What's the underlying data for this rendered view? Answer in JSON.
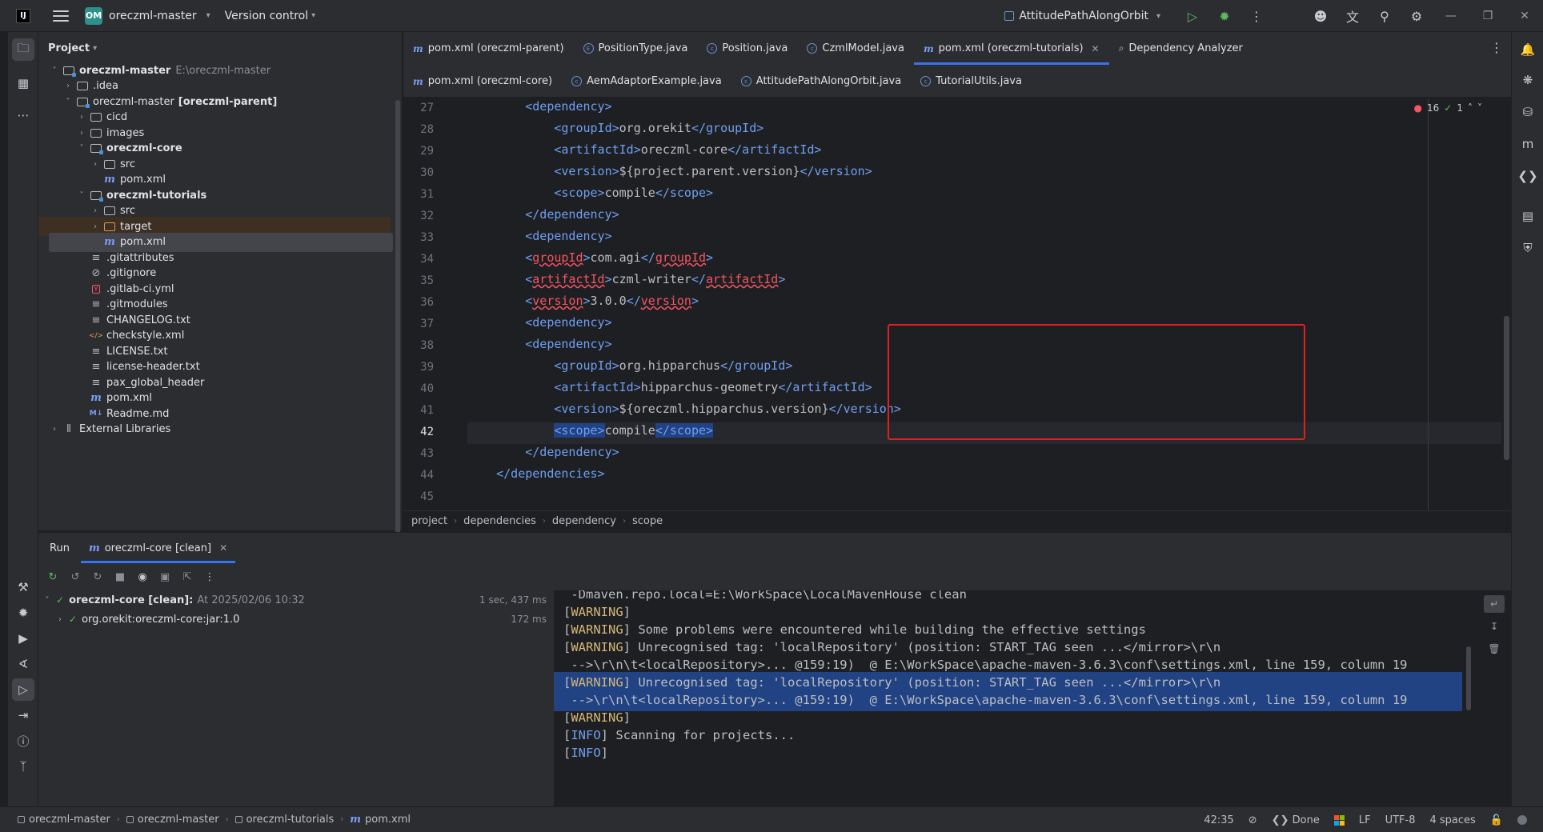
{
  "titlebar": {
    "logo": "IJ",
    "project_badge": "OM",
    "project_name": "oreczml-master",
    "vcs_label": "Version control",
    "run_config": "AttitudePathAlongOrbit"
  },
  "project_panel": {
    "title": "Project",
    "tree": [
      {
        "label": "oreczml-master",
        "extra": "E:\\oreczml-master",
        "indent": 0,
        "expanded": true,
        "icon": "module-folder",
        "bold": true
      },
      {
        "label": ".idea",
        "indent": 1,
        "expanded": false,
        "icon": "folder"
      },
      {
        "label": "oreczml-master",
        "extra": "[oreczml-parent]",
        "indent": 1,
        "expanded": true,
        "icon": "module-folder",
        "bold_extra": true
      },
      {
        "label": "cicd",
        "indent": 2,
        "expanded": false,
        "icon": "folder"
      },
      {
        "label": "images",
        "indent": 2,
        "expanded": false,
        "icon": "folder"
      },
      {
        "label": "oreczml-core",
        "indent": 2,
        "expanded": true,
        "icon": "module-folder",
        "bold": true
      },
      {
        "label": "src",
        "indent": 3,
        "expanded": false,
        "icon": "folder"
      },
      {
        "label": "pom.xml",
        "indent": 3,
        "icon": "maven-file"
      },
      {
        "label": "oreczml-tutorials",
        "indent": 2,
        "expanded": true,
        "icon": "module-folder",
        "bold": true
      },
      {
        "label": "src",
        "indent": 3,
        "expanded": false,
        "icon": "folder"
      },
      {
        "label": "target",
        "indent": 3,
        "expanded": false,
        "icon": "folder-orange",
        "highlight": true
      },
      {
        "label": "pom.xml",
        "indent": 3,
        "icon": "maven-file",
        "selected": true
      },
      {
        "label": ".gitattributes",
        "indent": 2,
        "icon": "lines-file"
      },
      {
        "label": ".gitignore",
        "indent": 2,
        "icon": "ignore-file"
      },
      {
        "label": ".gitlab-ci.yml",
        "indent": 2,
        "icon": "yaml-file"
      },
      {
        "label": ".gitmodules",
        "indent": 2,
        "icon": "lines-file"
      },
      {
        "label": "CHANGELOG.txt",
        "indent": 2,
        "icon": "lines-file"
      },
      {
        "label": "checkstyle.xml",
        "indent": 2,
        "icon": "xml-file"
      },
      {
        "label": "LICENSE.txt",
        "indent": 2,
        "icon": "lines-file"
      },
      {
        "label": "license-header.txt",
        "indent": 2,
        "icon": "lines-file"
      },
      {
        "label": "pax_global_header",
        "indent": 2,
        "icon": "lines-file"
      },
      {
        "label": "pom.xml",
        "indent": 2,
        "icon": "maven-file"
      },
      {
        "label": "Readme.md",
        "indent": 2,
        "icon": "markdown-file"
      },
      {
        "label": "External Libraries",
        "indent": 0,
        "expanded": false,
        "icon": "library"
      }
    ]
  },
  "editor_tabs": {
    "row1": [
      {
        "label": "pom.xml (oreczml-parent)",
        "icon": "maven"
      },
      {
        "label": "PositionType.java",
        "icon": "enum"
      },
      {
        "label": "Position.java",
        "icon": "class"
      },
      {
        "label": "CzmlModel.java",
        "icon": "class"
      },
      {
        "label": "pom.xml (oreczml-tutorials)",
        "icon": "maven",
        "active": true,
        "closable": true
      },
      {
        "label": "Dependency Analyzer",
        "icon": "analyzer"
      }
    ],
    "row2": [
      {
        "label": "pom.xml (oreczml-core)",
        "icon": "maven"
      },
      {
        "label": "AemAdaptorExample.java",
        "icon": "class"
      },
      {
        "label": "AttitudePathAlongOrbit.java",
        "icon": "class"
      },
      {
        "label": "TutorialUtils.java",
        "icon": "class"
      }
    ]
  },
  "editor": {
    "error_count": "16",
    "warning_count": "1",
    "current_line": 42,
    "lines": [
      {
        "n": "27",
        "indent": "        ",
        "parts": [
          [
            "t",
            "<dependency>"
          ]
        ]
      },
      {
        "n": "28",
        "indent": "            ",
        "parts": [
          [
            "t",
            "<groupId>"
          ],
          [
            "x",
            "org.orekit"
          ],
          [
            "t",
            "</groupId>"
          ]
        ]
      },
      {
        "n": "29",
        "indent": "            ",
        "parts": [
          [
            "t",
            "<artifactId>"
          ],
          [
            "x",
            "oreczml-core"
          ],
          [
            "t",
            "</artifactId>"
          ]
        ]
      },
      {
        "n": "30",
        "indent": "            ",
        "parts": [
          [
            "t",
            "<version>"
          ],
          [
            "x",
            "${project.parent.version}"
          ],
          [
            "t",
            "</version>"
          ]
        ]
      },
      {
        "n": "31",
        "indent": "            ",
        "parts": [
          [
            "t",
            "<scope>"
          ],
          [
            "x",
            "compile"
          ],
          [
            "t",
            "</scope>"
          ]
        ]
      },
      {
        "n": "32",
        "indent": "        ",
        "parts": [
          [
            "t",
            "</dependency>"
          ]
        ]
      },
      {
        "n": "33",
        "indent": "        ",
        "parts": [
          [
            "t",
            "<dependency>"
          ]
        ]
      },
      {
        "n": "34",
        "indent": "        ",
        "parts": [
          [
            "t",
            "<"
          ],
          [
            "e",
            "groupId"
          ],
          [
            "t",
            ">"
          ],
          [
            "x",
            "com.agi"
          ],
          [
            "t",
            "</"
          ],
          [
            "e",
            "groupId"
          ],
          [
            "t",
            ">"
          ]
        ]
      },
      {
        "n": "35",
        "indent": "        ",
        "parts": [
          [
            "t",
            "<"
          ],
          [
            "e",
            "artifactId"
          ],
          [
            "t",
            ">"
          ],
          [
            "x",
            "czml-writer"
          ],
          [
            "t",
            "</"
          ],
          [
            "e",
            "artifactId"
          ],
          [
            "t",
            ">"
          ]
        ]
      },
      {
        "n": "36",
        "indent": "        ",
        "parts": [
          [
            "t",
            "<"
          ],
          [
            "e",
            "version"
          ],
          [
            "t",
            ">"
          ],
          [
            "x",
            "3.0.0"
          ],
          [
            "t",
            "</"
          ],
          [
            "e",
            "version"
          ],
          [
            "t",
            ">"
          ]
        ]
      },
      {
        "n": "37",
        "indent": "        ",
        "parts": [
          [
            "t",
            "<dependency>"
          ]
        ]
      },
      {
        "n": "38",
        "indent": "        ",
        "parts": [
          [
            "t",
            "<dependency>"
          ]
        ]
      },
      {
        "n": "39",
        "indent": "            ",
        "parts": [
          [
            "t",
            "<groupId>"
          ],
          [
            "x",
            "org.hipparchus"
          ],
          [
            "t",
            "</groupId>"
          ]
        ]
      },
      {
        "n": "40",
        "indent": "            ",
        "parts": [
          [
            "t",
            "<artifactId>"
          ],
          [
            "x",
            "hipparchus-geometry"
          ],
          [
            "t",
            "</artifactId>"
          ]
        ]
      },
      {
        "n": "41",
        "indent": "            ",
        "parts": [
          [
            "t",
            "<version>"
          ],
          [
            "x",
            "${oreczml.hipparchus.version}"
          ],
          [
            "t",
            "</version>"
          ]
        ]
      },
      {
        "n": "42",
        "indent": "            ",
        "parts": [
          [
            "s",
            "<scope>"
          ],
          [
            "x",
            "compile"
          ],
          [
            "s",
            "</scope>"
          ]
        ]
      },
      {
        "n": "43",
        "indent": "        ",
        "parts": [
          [
            "t",
            "</dependency>"
          ]
        ]
      },
      {
        "n": "44",
        "indent": "    ",
        "parts": [
          [
            "t",
            "</dependencies>"
          ]
        ]
      },
      {
        "n": "45",
        "indent": "",
        "parts": []
      }
    ]
  },
  "breadcrumb": [
    "project",
    "dependencies",
    "dependency",
    "scope"
  ],
  "run_panel": {
    "title": "Run",
    "tab_label": "oreczml-core [clean]",
    "tree": [
      {
        "label": "oreczml-core [clean]:",
        "detail": "At 2025/02/06 10:32",
        "time": "1 sec, 437 ms",
        "indent": 0
      },
      {
        "label": "org.orekit:oreczml-core:jar:1.0",
        "detail": "",
        "time": "172 ms",
        "indent": 1
      }
    ],
    "console": [
      {
        "level": "",
        "text": " -Dmaven.repo.local=E:\\WorkSpace\\LocalMavenHouse clean"
      },
      {
        "level": "WARNING",
        "text": ""
      },
      {
        "level": "WARNING",
        "text": " Some problems were encountered while building the effective settings"
      },
      {
        "level": "WARNING",
        "text": " Unrecognised tag: 'localRepository' (position: START_TAG seen ...</mirror>\\r\\n"
      },
      {
        "level": "",
        "text": " -->\\r\\n\\t<localRepository>... @159:19)  @ E:\\WorkSpace\\apache-maven-3.6.3\\conf\\settings.xml, line 159, column 19"
      },
      {
        "level": "WARNING",
        "text": " Unrecognised tag: 'localRepository' (position: START_TAG seen ...</mirror>\\r\\n",
        "selected": true
      },
      {
        "level": "",
        "text": " -->\\r\\n\\t<localRepository>... @159:19)  @ E:\\WorkSpace\\apache-maven-3.6.3\\conf\\settings.xml, line 159, column 19",
        "selected": true
      },
      {
        "level": "WARNING",
        "text": ""
      },
      {
        "level": "INFO",
        "text": " Scanning for projects..."
      },
      {
        "level": "INFO",
        "text": ""
      }
    ]
  },
  "statusbar": {
    "crumbs": [
      "oreczml-master",
      "oreczml-master",
      "oreczml-tutorials",
      "pom.xml"
    ],
    "position": "42:35",
    "ai_status": "Done",
    "line_sep": "LF",
    "encoding": "UTF-8",
    "indent": "4 spaces"
  }
}
